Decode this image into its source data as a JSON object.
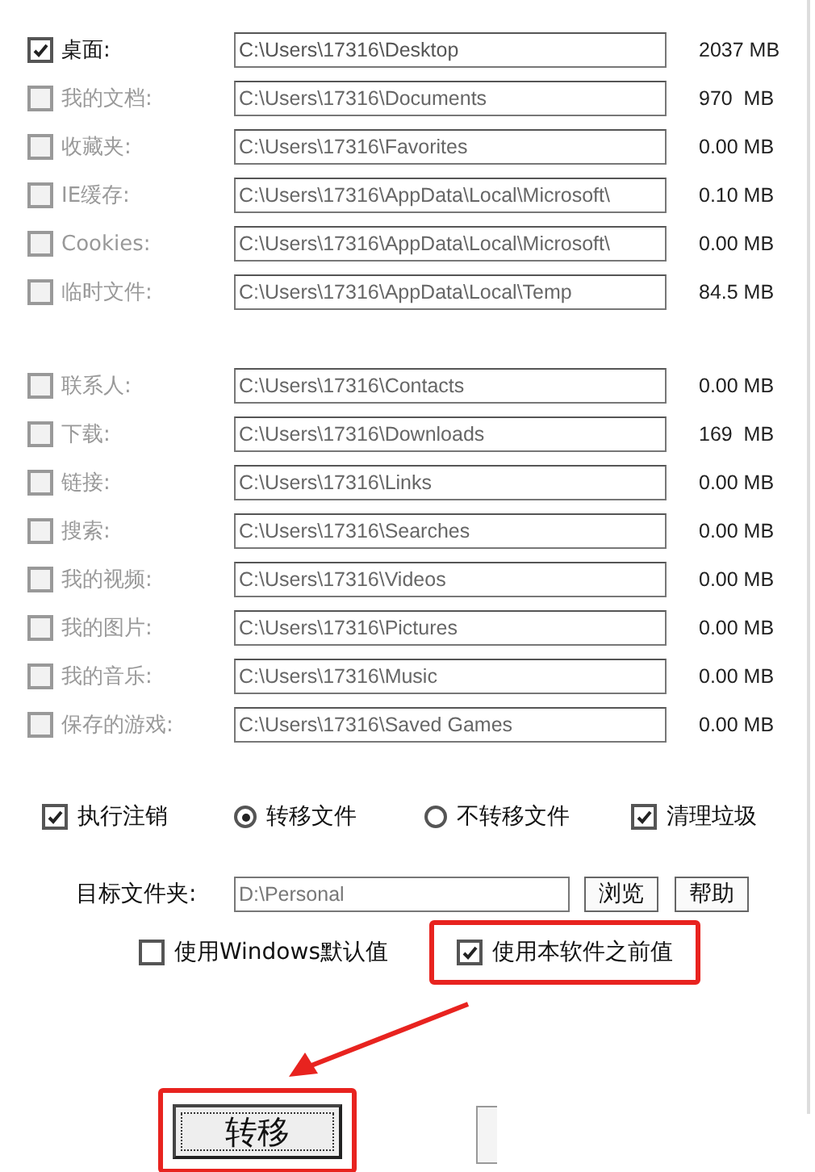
{
  "folders_group_1": [
    {
      "label": "桌面:",
      "path": "C:\\Users\\17316\\Desktop",
      "size": "2037 MB",
      "checked": true,
      "disabled": false
    },
    {
      "label": "我的文档:",
      "path": "C:\\Users\\17316\\Documents",
      "size": "970  MB",
      "checked": false,
      "disabled": true
    },
    {
      "label": "收藏夹:",
      "path": "C:\\Users\\17316\\Favorites",
      "size": "0.00 MB",
      "checked": false,
      "disabled": true
    },
    {
      "label": "IE缓存:",
      "path": "C:\\Users\\17316\\AppData\\Local\\Microsoft\\",
      "size": "0.10 MB",
      "checked": false,
      "disabled": true
    },
    {
      "label": "Cookies:",
      "path": "C:\\Users\\17316\\AppData\\Local\\Microsoft\\",
      "size": "0.00 MB",
      "checked": false,
      "disabled": true
    },
    {
      "label": "临时文件:",
      "path": "C:\\Users\\17316\\AppData\\Local\\Temp",
      "size": "84.5 MB",
      "checked": false,
      "disabled": true
    }
  ],
  "folders_group_2": [
    {
      "label": "联系人:",
      "path": "C:\\Users\\17316\\Contacts",
      "size": "0.00 MB",
      "checked": false,
      "disabled": true
    },
    {
      "label": "下载:",
      "path": "C:\\Users\\17316\\Downloads",
      "size": "169  MB",
      "checked": false,
      "disabled": true
    },
    {
      "label": "链接:",
      "path": "C:\\Users\\17316\\Links",
      "size": "0.00 MB",
      "checked": false,
      "disabled": true
    },
    {
      "label": "搜索:",
      "path": "C:\\Users\\17316\\Searches",
      "size": "0.00 MB",
      "checked": false,
      "disabled": true
    },
    {
      "label": "我的视频:",
      "path": "C:\\Users\\17316\\Videos",
      "size": "0.00 MB",
      "checked": false,
      "disabled": true
    },
    {
      "label": "我的图片:",
      "path": "C:\\Users\\17316\\Pictures",
      "size": "0.00 MB",
      "checked": false,
      "disabled": true
    },
    {
      "label": "我的音乐:",
      "path": "C:\\Users\\17316\\Music",
      "size": "0.00 MB",
      "checked": false,
      "disabled": true
    },
    {
      "label": "保存的游戏:",
      "path": "C:\\Users\\17316\\Saved Games",
      "size": "0.00 MB",
      "checked": false,
      "disabled": true
    }
  ],
  "options": [
    {
      "kind": "checkbox",
      "label": "执行注销",
      "checked": true
    },
    {
      "kind": "radio",
      "label": "转移文件",
      "selected": true
    },
    {
      "kind": "radio",
      "label": "不转移文件",
      "selected": false
    },
    {
      "kind": "checkbox",
      "label": "清理垃圾",
      "checked": true
    }
  ],
  "target": {
    "label": "目标文件夹:",
    "value": "D:\\Personal"
  },
  "target_buttons": [
    "浏览",
    "帮助"
  ],
  "defaults": [
    {
      "label": "使用Windows默认值",
      "checked": false,
      "highlighted": false
    },
    {
      "label": "使用本软件之前值",
      "checked": true,
      "highlighted": true
    }
  ],
  "transfer_button": {
    "label": "转移",
    "highlighted": true
  }
}
